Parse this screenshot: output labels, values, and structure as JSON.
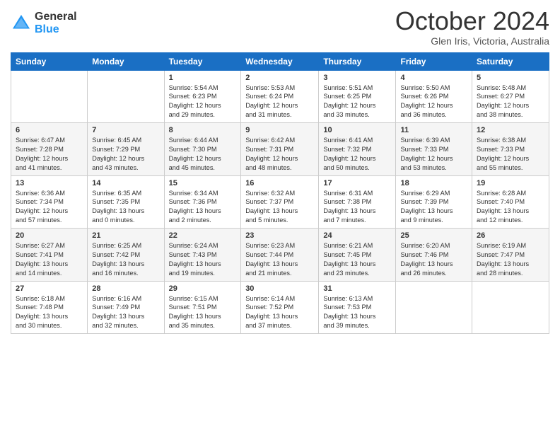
{
  "header": {
    "logo": {
      "general": "General",
      "blue": "Blue"
    },
    "title": "October 2024",
    "location": "Glen Iris, Victoria, Australia"
  },
  "weekdays": [
    "Sunday",
    "Monday",
    "Tuesday",
    "Wednesday",
    "Thursday",
    "Friday",
    "Saturday"
  ],
  "rows": [
    [
      {
        "day": "",
        "lines": []
      },
      {
        "day": "",
        "lines": []
      },
      {
        "day": "1",
        "lines": [
          "Sunrise: 5:54 AM",
          "Sunset: 6:23 PM",
          "Daylight: 12 hours",
          "and 29 minutes."
        ]
      },
      {
        "day": "2",
        "lines": [
          "Sunrise: 5:53 AM",
          "Sunset: 6:24 PM",
          "Daylight: 12 hours",
          "and 31 minutes."
        ]
      },
      {
        "day": "3",
        "lines": [
          "Sunrise: 5:51 AM",
          "Sunset: 6:25 PM",
          "Daylight: 12 hours",
          "and 33 minutes."
        ]
      },
      {
        "day": "4",
        "lines": [
          "Sunrise: 5:50 AM",
          "Sunset: 6:26 PM",
          "Daylight: 12 hours",
          "and 36 minutes."
        ]
      },
      {
        "day": "5",
        "lines": [
          "Sunrise: 5:48 AM",
          "Sunset: 6:27 PM",
          "Daylight: 12 hours",
          "and 38 minutes."
        ]
      }
    ],
    [
      {
        "day": "6",
        "lines": [
          "Sunrise: 6:47 AM",
          "Sunset: 7:28 PM",
          "Daylight: 12 hours",
          "and 41 minutes."
        ]
      },
      {
        "day": "7",
        "lines": [
          "Sunrise: 6:45 AM",
          "Sunset: 7:29 PM",
          "Daylight: 12 hours",
          "and 43 minutes."
        ]
      },
      {
        "day": "8",
        "lines": [
          "Sunrise: 6:44 AM",
          "Sunset: 7:30 PM",
          "Daylight: 12 hours",
          "and 45 minutes."
        ]
      },
      {
        "day": "9",
        "lines": [
          "Sunrise: 6:42 AM",
          "Sunset: 7:31 PM",
          "Daylight: 12 hours",
          "and 48 minutes."
        ]
      },
      {
        "day": "10",
        "lines": [
          "Sunrise: 6:41 AM",
          "Sunset: 7:32 PM",
          "Daylight: 12 hours",
          "and 50 minutes."
        ]
      },
      {
        "day": "11",
        "lines": [
          "Sunrise: 6:39 AM",
          "Sunset: 7:33 PM",
          "Daylight: 12 hours",
          "and 53 minutes."
        ]
      },
      {
        "day": "12",
        "lines": [
          "Sunrise: 6:38 AM",
          "Sunset: 7:33 PM",
          "Daylight: 12 hours",
          "and 55 minutes."
        ]
      }
    ],
    [
      {
        "day": "13",
        "lines": [
          "Sunrise: 6:36 AM",
          "Sunset: 7:34 PM",
          "Daylight: 12 hours",
          "and 57 minutes."
        ]
      },
      {
        "day": "14",
        "lines": [
          "Sunrise: 6:35 AM",
          "Sunset: 7:35 PM",
          "Daylight: 13 hours",
          "and 0 minutes."
        ]
      },
      {
        "day": "15",
        "lines": [
          "Sunrise: 6:34 AM",
          "Sunset: 7:36 PM",
          "Daylight: 13 hours",
          "and 2 minutes."
        ]
      },
      {
        "day": "16",
        "lines": [
          "Sunrise: 6:32 AM",
          "Sunset: 7:37 PM",
          "Daylight: 13 hours",
          "and 5 minutes."
        ]
      },
      {
        "day": "17",
        "lines": [
          "Sunrise: 6:31 AM",
          "Sunset: 7:38 PM",
          "Daylight: 13 hours",
          "and 7 minutes."
        ]
      },
      {
        "day": "18",
        "lines": [
          "Sunrise: 6:29 AM",
          "Sunset: 7:39 PM",
          "Daylight: 13 hours",
          "and 9 minutes."
        ]
      },
      {
        "day": "19",
        "lines": [
          "Sunrise: 6:28 AM",
          "Sunset: 7:40 PM",
          "Daylight: 13 hours",
          "and 12 minutes."
        ]
      }
    ],
    [
      {
        "day": "20",
        "lines": [
          "Sunrise: 6:27 AM",
          "Sunset: 7:41 PM",
          "Daylight: 13 hours",
          "and 14 minutes."
        ]
      },
      {
        "day": "21",
        "lines": [
          "Sunrise: 6:25 AM",
          "Sunset: 7:42 PM",
          "Daylight: 13 hours",
          "and 16 minutes."
        ]
      },
      {
        "day": "22",
        "lines": [
          "Sunrise: 6:24 AM",
          "Sunset: 7:43 PM",
          "Daylight: 13 hours",
          "and 19 minutes."
        ]
      },
      {
        "day": "23",
        "lines": [
          "Sunrise: 6:23 AM",
          "Sunset: 7:44 PM",
          "Daylight: 13 hours",
          "and 21 minutes."
        ]
      },
      {
        "day": "24",
        "lines": [
          "Sunrise: 6:21 AM",
          "Sunset: 7:45 PM",
          "Daylight: 13 hours",
          "and 23 minutes."
        ]
      },
      {
        "day": "25",
        "lines": [
          "Sunrise: 6:20 AM",
          "Sunset: 7:46 PM",
          "Daylight: 13 hours",
          "and 26 minutes."
        ]
      },
      {
        "day": "26",
        "lines": [
          "Sunrise: 6:19 AM",
          "Sunset: 7:47 PM",
          "Daylight: 13 hours",
          "and 28 minutes."
        ]
      }
    ],
    [
      {
        "day": "27",
        "lines": [
          "Sunrise: 6:18 AM",
          "Sunset: 7:48 PM",
          "Daylight: 13 hours",
          "and 30 minutes."
        ]
      },
      {
        "day": "28",
        "lines": [
          "Sunrise: 6:16 AM",
          "Sunset: 7:49 PM",
          "Daylight: 13 hours",
          "and 32 minutes."
        ]
      },
      {
        "day": "29",
        "lines": [
          "Sunrise: 6:15 AM",
          "Sunset: 7:51 PM",
          "Daylight: 13 hours",
          "and 35 minutes."
        ]
      },
      {
        "day": "30",
        "lines": [
          "Sunrise: 6:14 AM",
          "Sunset: 7:52 PM",
          "Daylight: 13 hours",
          "and 37 minutes."
        ]
      },
      {
        "day": "31",
        "lines": [
          "Sunrise: 6:13 AM",
          "Sunset: 7:53 PM",
          "Daylight: 13 hours",
          "and 39 minutes."
        ]
      },
      {
        "day": "",
        "lines": []
      },
      {
        "day": "",
        "lines": []
      }
    ]
  ]
}
